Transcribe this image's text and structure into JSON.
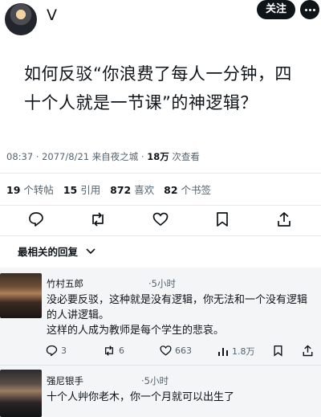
{
  "post": {
    "author_name": "V",
    "follow_label": "关注",
    "title": "如何反驳“你浪费了每人一分钟，四十个人就是一节课”的神逻辑？",
    "meta_prefix": "08:37 · 2077/8/21 来自夜之城 · ",
    "views_count": "18万",
    "views_label": " 次查看"
  },
  "stats": [
    {
      "count": "19",
      "label": " 个转帖"
    },
    {
      "count": "15",
      "label": " 引用"
    },
    {
      "count": "872",
      "label": " 喜欢"
    },
    {
      "count": "82",
      "label": " 个书签"
    }
  ],
  "sort": {
    "label": "最相关的回复"
  },
  "replies": [
    {
      "name": "竹村五郎",
      "time": "·5小时",
      "text1": "没必要反驳，这种就是没有逻辑，你无法和一个没有逻辑的人讲逻辑。",
      "text2": "这样的人成为教师是每个学生的悲哀。",
      "comments": "3",
      "reposts": "6",
      "likes": "663",
      "views": "1.8万"
    },
    {
      "name": "强尼银手",
      "time": "·5小时",
      "text1": "十个人艸你老木，你一个月就可以出生了"
    }
  ],
  "icons": {
    "more": "more-icon",
    "reply": "reply-icon",
    "repost": "repost-icon",
    "like": "heart-icon",
    "bookmark": "bookmark-icon",
    "share": "share-icon",
    "views": "views-icon",
    "chevron": "chevron-down-icon"
  },
  "colors": {
    "text": "#0f1419",
    "secondary": "#536471",
    "reply_bg": "#f4f5f6",
    "follow_bg": "#0f1419"
  }
}
